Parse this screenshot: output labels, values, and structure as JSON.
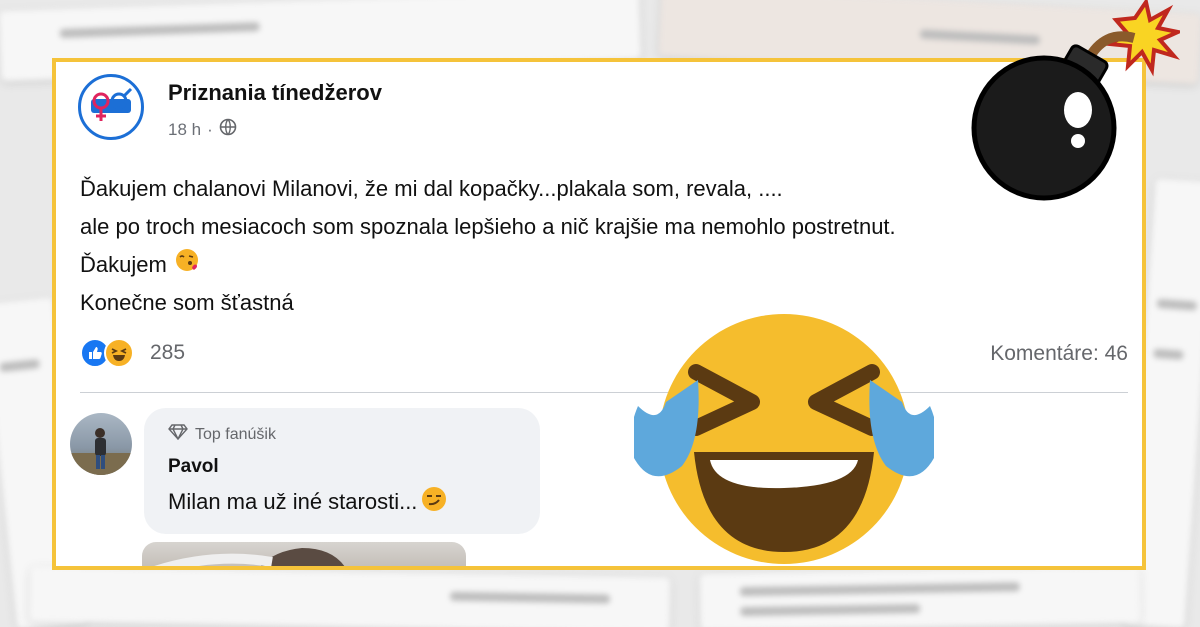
{
  "post": {
    "page_name": "Priznania tínedžerov",
    "time": "18 h",
    "separator": "·",
    "lines": [
      "Ďakujem chalanovi Milanovi, že mi dal kopačky...plakala som, revala, ....",
      "ale po troch mesiacoch som spoznala lepšieho a nič krajšie ma nemohlo postretnut.",
      "Ďakujem",
      "Konečne som šťastná"
    ],
    "reaction_count": "285",
    "comments_label": "Komentáre: 46"
  },
  "comment": {
    "badge": "Top fanúšik",
    "author": "Pavol",
    "text": "Milan ma už iné starosti..."
  },
  "icons": {
    "globe": "globe-icon",
    "like": "like-reaction-icon",
    "haha": "haha-reaction-icon",
    "kiss_emoji": "face-blowing-kiss-emoji",
    "smirk_emoji": "smirking-face-emoji",
    "diamond": "diamond-icon",
    "bomb": "bomb-sticker",
    "laughing": "tears-of-joy-sticker"
  },
  "colors": {
    "frame": "#f5c33a",
    "facebook_blue": "#1877f2",
    "emoji_yellow": "#f5bd2d"
  }
}
